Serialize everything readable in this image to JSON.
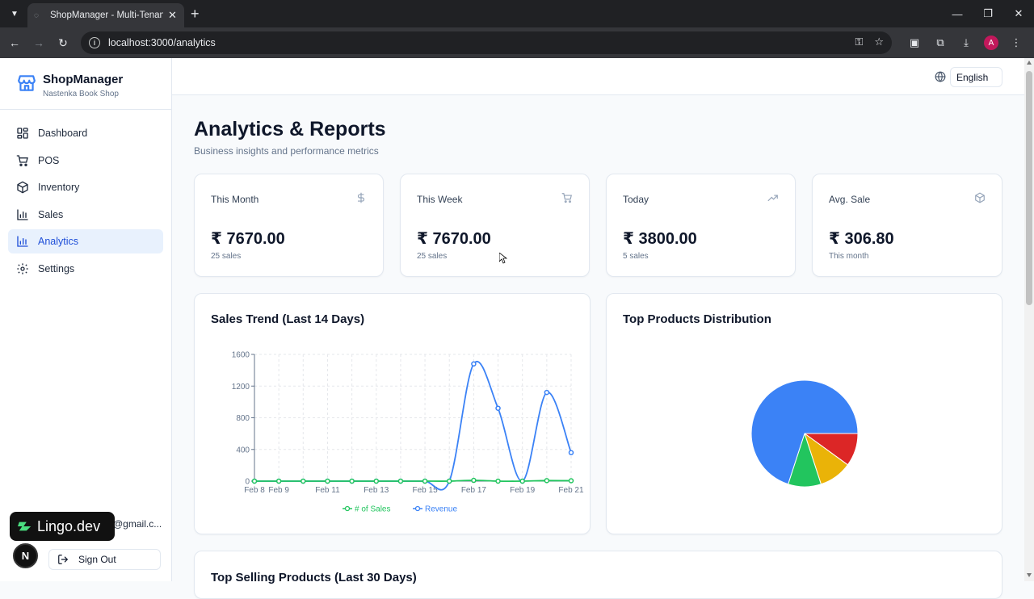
{
  "browser": {
    "tab_title": "ShopManager - Multi-Tenant POS",
    "url": "localhost:3000/analytics",
    "profile_initial": "A"
  },
  "sidebar": {
    "brand": "ShopManager",
    "shop_name": "Nastenka Book Shop",
    "items": [
      {
        "label": "Dashboard",
        "icon": "dashboard-icon"
      },
      {
        "label": "POS",
        "icon": "cart-icon"
      },
      {
        "label": "Inventory",
        "icon": "package-icon"
      },
      {
        "label": "Sales",
        "icon": "bar-chart-icon"
      },
      {
        "label": "Analytics",
        "icon": "bar-chart-icon",
        "active": true
      },
      {
        "label": "Settings",
        "icon": "gear-icon"
      }
    ],
    "user_email": "@gmail.c...",
    "sign_out": "Sign Out",
    "lingo_badge": "Lingo.dev",
    "n_badge": "N"
  },
  "header": {
    "language": "English"
  },
  "page": {
    "title": "Analytics & Reports",
    "subtitle": "Business insights and performance metrics"
  },
  "stats": [
    {
      "label": "This Month",
      "value": "₹ 7670.00",
      "sub": "25 sales",
      "icon": "dollar-icon"
    },
    {
      "label": "This Week",
      "value": "₹ 7670.00",
      "sub": "25 sales",
      "icon": "cart-icon"
    },
    {
      "label": "Today",
      "value": "₹ 3800.00",
      "sub": "5 sales",
      "icon": "trending-up-icon"
    },
    {
      "label": "Avg. Sale",
      "value": "₹ 306.80",
      "sub": "This month",
      "icon": "package-icon"
    }
  ],
  "sales_trend": {
    "title": "Sales Trend (Last 14 Days)"
  },
  "top_products": {
    "title": "Top Products Distribution"
  },
  "top_selling": {
    "title": "Top Selling Products (Last 30 Days)"
  },
  "colors": {
    "accent": "#1d4ed8",
    "sales_line": "#22c55e",
    "revenue_line": "#3b82f6",
    "pie": [
      "#3b82f6",
      "#dc2626",
      "#eab308",
      "#22c55e"
    ]
  },
  "chart_data": [
    {
      "type": "line",
      "title": "Sales Trend (Last 14 Days)",
      "x": [
        "Feb 8",
        "Feb 9",
        "Feb 10",
        "Feb 11",
        "Feb 12",
        "Feb 13",
        "Feb 14",
        "Feb 15",
        "Feb 16",
        "Feb 17",
        "Feb 18",
        "Feb 19",
        "Feb 20",
        "Feb 21"
      ],
      "x_tick_labels": [
        "Feb 8",
        "Feb 9",
        "Feb 11",
        "Feb 13",
        "Feb 15",
        "Feb 17",
        "Feb 19",
        "Feb 21"
      ],
      "y_ticks": [
        0,
        400,
        800,
        1200,
        1600
      ],
      "ylim": [
        0,
        1600
      ],
      "grid": true,
      "legend_position": "bottom",
      "series": [
        {
          "name": "# of Sales",
          "color": "#22c55e",
          "values": [
            0,
            0,
            0,
            0,
            0,
            0,
            0,
            0,
            0,
            10,
            0,
            0,
            7,
            5
          ]
        },
        {
          "name": "Revenue",
          "color": "#3b82f6",
          "values": [
            0,
            0,
            0,
            0,
            0,
            0,
            0,
            0,
            0,
            1480,
            920,
            0,
            1120,
            360
          ]
        }
      ]
    },
    {
      "type": "pie",
      "title": "Top Products Distribution",
      "values": [
        70,
        10,
        10,
        10
      ],
      "colors": [
        "#3b82f6",
        "#dc2626",
        "#eab308",
        "#22c55e"
      ]
    }
  ]
}
